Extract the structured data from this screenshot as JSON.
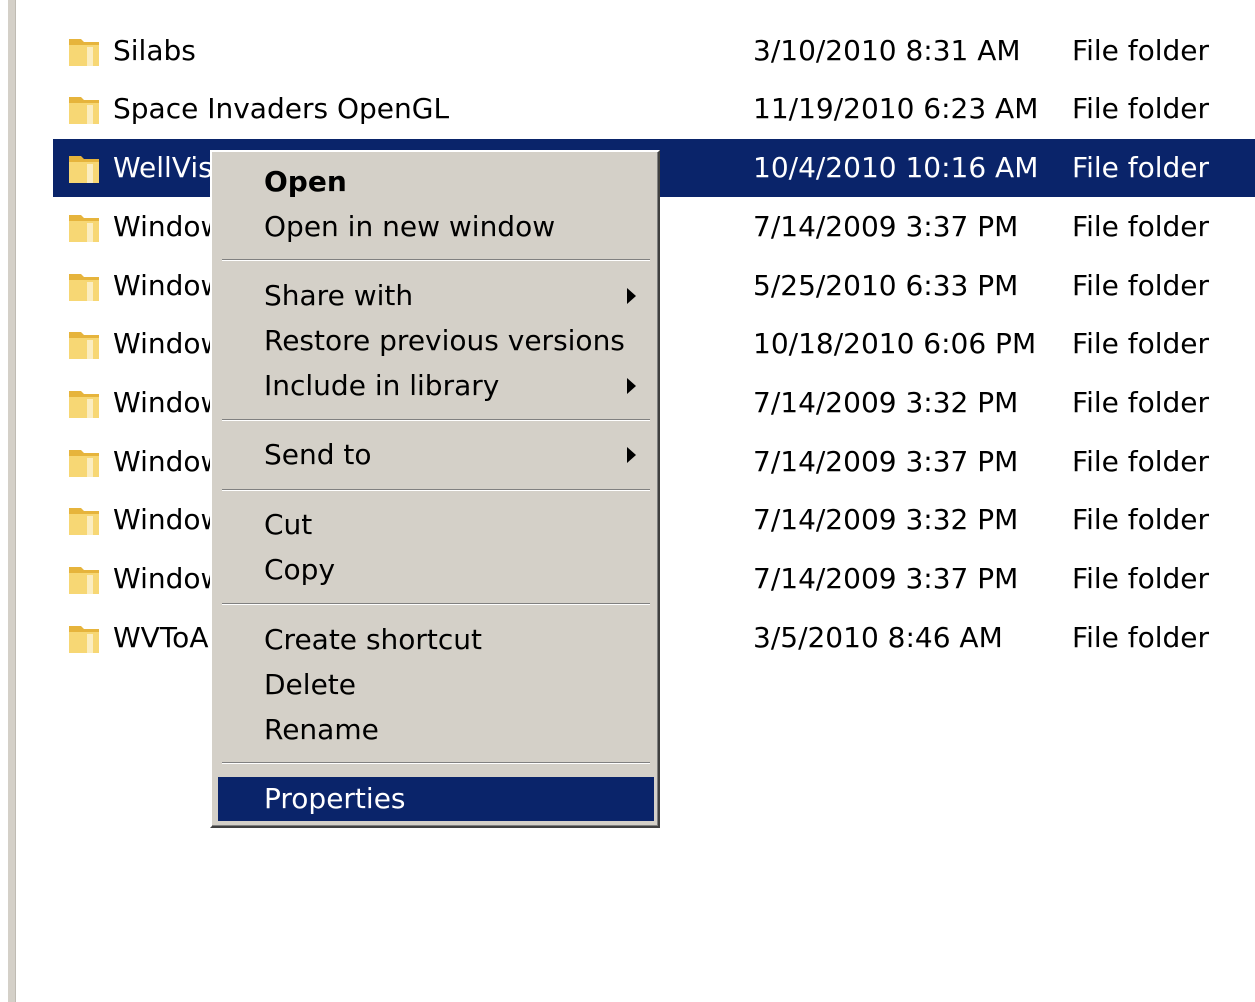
{
  "rows": [
    {
      "name": "Silabs",
      "date": "3/10/2010 8:31 AM",
      "type": "File folder"
    },
    {
      "name": "Space Invaders OpenGL",
      "date": "11/19/2010 6:23 AM",
      "type": "File folder"
    },
    {
      "name": "WellVisi",
      "date": "10/4/2010 10:16 AM",
      "type": "File folder"
    },
    {
      "name": "Window",
      "date": "7/14/2009 3:37 PM",
      "type": "File folder"
    },
    {
      "name": "Window",
      "date": "5/25/2010 6:33 PM",
      "type": "File folder"
    },
    {
      "name": "Window",
      "date": "10/18/2010 6:06 PM",
      "type": "File folder"
    },
    {
      "name": "Window",
      "date": "7/14/2009 3:32 PM",
      "type": "File folder"
    },
    {
      "name": "Window",
      "date": "7/14/2009 3:37 PM",
      "type": "File folder"
    },
    {
      "name": "Window",
      "date": "7/14/2009 3:32 PM",
      "type": "File folder"
    },
    {
      "name": "Window",
      "date": "7/14/2009 3:37 PM",
      "type": "File folder"
    },
    {
      "name": "WVToAl",
      "date": "3/5/2010 8:46 AM",
      "type": "File folder"
    }
  ],
  "selected_row": 2,
  "menu": {
    "open": "Open",
    "open_new_window": "Open in new window",
    "share_with": "Share with",
    "restore_previous_versions": "Restore previous versions",
    "include_in_library": "Include in library",
    "send_to": "Send to",
    "cut": "Cut",
    "copy": "Copy",
    "create_shortcut": "Create shortcut",
    "delete": "Delete",
    "rename": "Rename",
    "properties": "Properties"
  },
  "colors": {
    "selection": "#0a246a",
    "menu_background": "#d4d0c8",
    "folder": "#f2c94c"
  },
  "icons": {
    "folder": "folder-icon",
    "submenu": "submenu-arrow-icon"
  }
}
